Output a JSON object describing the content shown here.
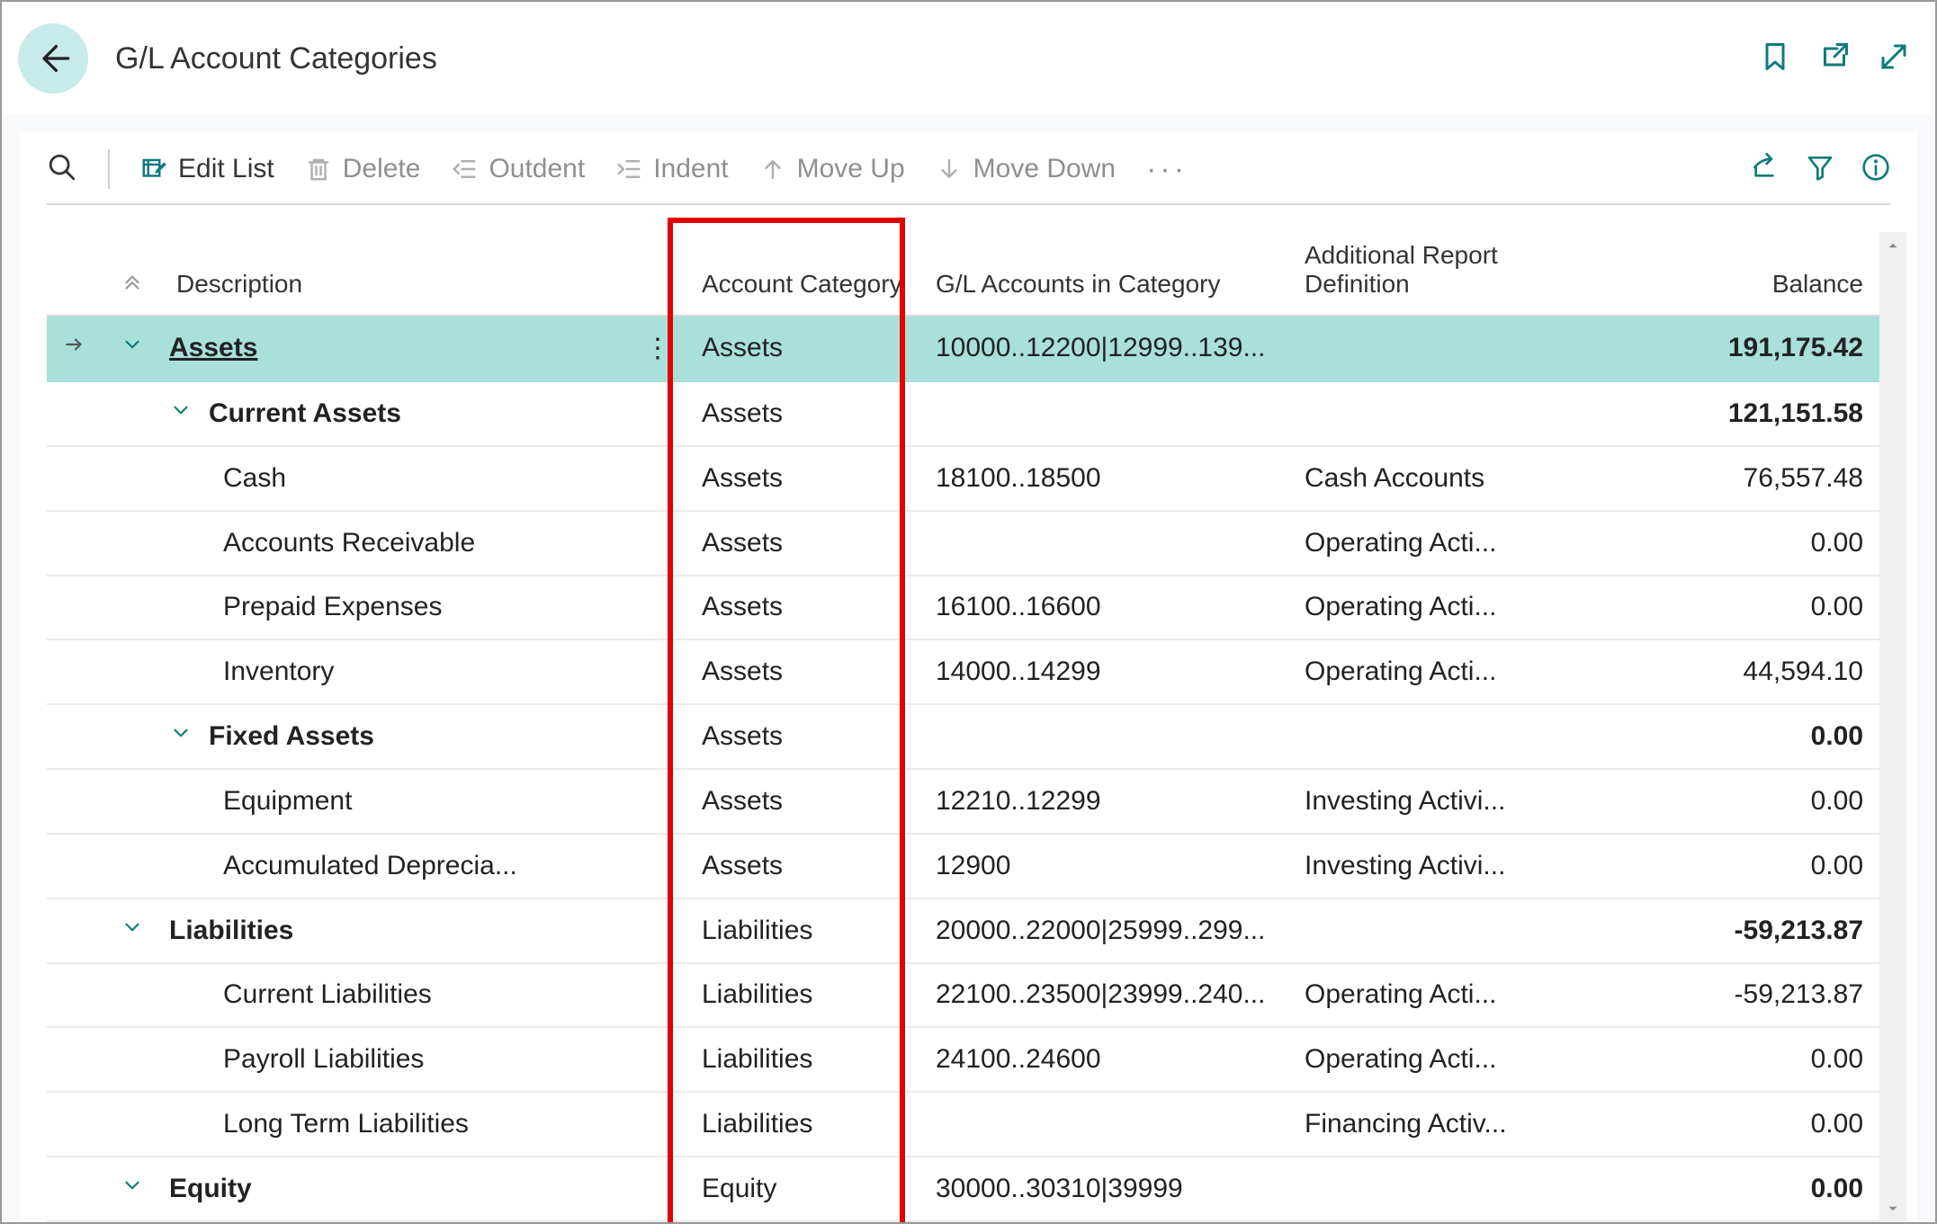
{
  "header": {
    "title": "G/L Account Categories"
  },
  "toolbar": {
    "edit_list": "Edit List",
    "delete": "Delete",
    "outdent": "Outdent",
    "indent": "Indent",
    "move_up": "Move Up",
    "move_down": "Move Down"
  },
  "columns": {
    "description": "Description",
    "account_category": "Account Category",
    "gl_accounts": "G/L Accounts in Category",
    "report_def": "Additional Report Definition",
    "balance": "Balance"
  },
  "rows": [
    {
      "indent": 0,
      "description": "Assets",
      "bold": true,
      "underline": true,
      "expandable": true,
      "selected": true,
      "category": "Assets",
      "gl": "10000..12200|12999..139...",
      "def": "",
      "balance": "191,175.42",
      "bal_bold": true
    },
    {
      "indent": 1,
      "description": "Current Assets",
      "bold": true,
      "expandable": true,
      "category": "Assets",
      "gl": "",
      "def": "",
      "balance": "121,151.58",
      "bal_bold": true
    },
    {
      "indent": 2,
      "description": "Cash",
      "category": "Assets",
      "gl": "18100..18500",
      "def": "Cash Accounts",
      "balance": "76,557.48"
    },
    {
      "indent": 2,
      "description": "Accounts Receivable",
      "category": "Assets",
      "gl": "",
      "def": "Operating Acti...",
      "balance": "0.00"
    },
    {
      "indent": 2,
      "description": "Prepaid Expenses",
      "category": "Assets",
      "gl": "16100..16600",
      "def": "Operating Acti...",
      "balance": "0.00"
    },
    {
      "indent": 2,
      "description": "Inventory",
      "category": "Assets",
      "gl": "14000..14299",
      "def": "Operating Acti...",
      "balance": "44,594.10"
    },
    {
      "indent": 1,
      "description": "Fixed Assets",
      "bold": true,
      "expandable": true,
      "category": "Assets",
      "gl": "",
      "def": "",
      "balance": "0.00",
      "bal_bold": true
    },
    {
      "indent": 2,
      "description": "Equipment",
      "category": "Assets",
      "gl": "12210..12299",
      "def": "Investing Activi...",
      "balance": "0.00"
    },
    {
      "indent": 2,
      "description": "Accumulated Deprecia...",
      "category": "Assets",
      "gl": "12900",
      "def": "Investing Activi...",
      "balance": "0.00"
    },
    {
      "indent": 0,
      "description": "Liabilities",
      "bold": true,
      "expandable": true,
      "category": "Liabilities",
      "gl": "20000..22000|25999..299...",
      "def": "",
      "balance": "-59,213.87",
      "bal_bold": true
    },
    {
      "indent": 2,
      "description": "Current Liabilities",
      "category": "Liabilities",
      "gl": "22100..23500|23999..240...",
      "def": "Operating Acti...",
      "balance": "-59,213.87"
    },
    {
      "indent": 2,
      "description": "Payroll Liabilities",
      "category": "Liabilities",
      "gl": "24100..24600",
      "def": "Operating Acti...",
      "balance": "0.00"
    },
    {
      "indent": 2,
      "description": "Long Term Liabilities",
      "category": "Liabilities",
      "gl": "",
      "def": "Financing Activ...",
      "balance": "0.00"
    },
    {
      "indent": 0,
      "description": "Equity",
      "bold": true,
      "expandable": true,
      "category": "Equity",
      "gl": "30000..30310|39999",
      "def": "",
      "balance": "0.00",
      "bal_bold": true
    }
  ],
  "highlight": {
    "col": "account_category"
  }
}
